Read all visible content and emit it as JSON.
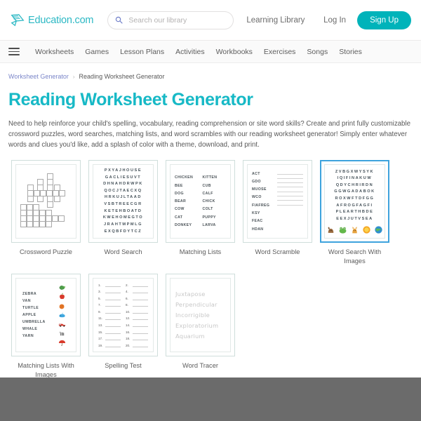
{
  "header": {
    "logo_text": "Education.com",
    "logo_icon": "pencil-logo-icon",
    "search": {
      "placeholder": "Search our library",
      "value": "",
      "icon": "search-icon"
    },
    "learning_library": "Learning Library",
    "log_in": "Log In",
    "sign_up": "Sign Up",
    "accent_color": "#00b3ba"
  },
  "nav": {
    "menu_icon": "hamburger-icon",
    "items": [
      "Worksheets",
      "Games",
      "Lesson Plans",
      "Activities",
      "Workbooks",
      "Exercises",
      "Songs",
      "Stories"
    ]
  },
  "breadcrumb": {
    "parent": "Worksheet Generator",
    "separator": "›",
    "current": "Reading Worksheet Generator"
  },
  "page": {
    "title": "Reading Worksheet Generator",
    "title_color": "#17b9c6",
    "intro": "Need to help reinforce your child's spelling, vocabulary, reading comprehension or site word skills? Create and print fully customizable crossword puzzles, word searches, matching lists, and word scrambles with our reading worksheet generator! Simply enter whatever words and clues you'd like, add a splash of color with a theme, download, and print."
  },
  "cards": [
    {
      "id": "crossword-puzzle",
      "label": "Crossword Puzzle",
      "selected": false
    },
    {
      "id": "word-search",
      "label": "Word Search",
      "selected": false,
      "grid": [
        "PXYAJHOUSE",
        "GACLIESUVT",
        "DHNAHDRWPK",
        "QOCJTAECXQ",
        "HRKUJLTAAD",
        "VSBTREECGR",
        "KETEHBOATD",
        "KWEHOMEGTO",
        "JRAHTMPMLG",
        "EXQBFDYTCZ"
      ]
    },
    {
      "id": "matching-lists",
      "label": "Matching Lists",
      "selected": false,
      "left": [
        "CHICKEN",
        "BEE",
        "DOG",
        "BEAR",
        "COW",
        "CAT",
        "DONKEY"
      ],
      "right": [
        "KITTEN",
        "CUB",
        "CALF",
        "CHICK",
        "COLT",
        "PUPPY",
        "LARVA"
      ]
    },
    {
      "id": "word-scramble",
      "label": "Word Scramble",
      "selected": false,
      "words": [
        "ACT",
        "GDO",
        "MUOSE",
        "WCO",
        "FIAFREG",
        "KSY",
        "FEAC",
        "HDAN"
      ]
    },
    {
      "id": "word-search-with-images",
      "label": "Word Search With Images",
      "selected": true,
      "selected_border_color": "#3ea3dd",
      "grid": [
        "ZVBGXWYSYK",
        "IQIFINAKUW",
        "QDYCHRIRDN",
        "GGWGADABOK",
        "ROXWFTDFGG",
        "AFROGFAGFI",
        "PLEARTHBDE",
        "EEXJUTVSEA"
      ],
      "images": [
        "dog-icon",
        "frog-icon",
        "cat-icon",
        "sun-icon",
        "earth-icon"
      ]
    },
    {
      "id": "matching-lists-with-images",
      "label": "Matching Lists With Images",
      "selected": false,
      "words": [
        "ZEBRA",
        "VAN",
        "TURTLE",
        "APPLE",
        "UMBRELLA",
        "WHALE",
        "YARN"
      ],
      "images": [
        "turtle-icon",
        "apple-icon",
        "yarn-icon",
        "whale-icon",
        "van-icon",
        "zebra-icon",
        "umbrella-icon"
      ]
    },
    {
      "id": "spelling-test",
      "label": "Spelling Test",
      "selected": false,
      "numbers_left": [
        "1.",
        "3.",
        "5.",
        "7.",
        "9.",
        "11.",
        "13.",
        "15.",
        "17.",
        "19."
      ],
      "numbers_right": [
        "2.",
        "4.",
        "6.",
        "8.",
        "10.",
        "12.",
        "14.",
        "16.",
        "18.",
        "20."
      ]
    },
    {
      "id": "word-tracer",
      "label": "Word Tracer",
      "selected": false,
      "words": [
        "Juxtapose",
        "Perpendicular",
        "Incorrigible",
        "Exploratorium",
        "Aquarium"
      ]
    }
  ]
}
